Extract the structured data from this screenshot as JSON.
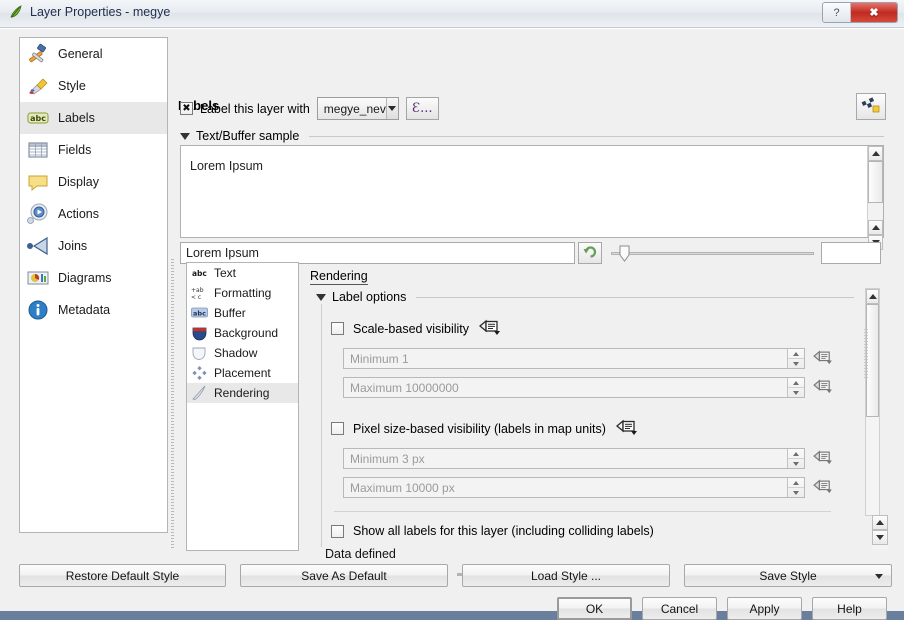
{
  "window": {
    "title": "Layer Properties - megye",
    "app_icon": "qgis-leaf-icon",
    "help_button": "?",
    "close_button": "✖"
  },
  "sidebar": {
    "items": [
      {
        "label": "General",
        "icon": "hammer-icon",
        "selected": false
      },
      {
        "label": "Style",
        "icon": "brush-icon",
        "selected": false
      },
      {
        "label": "Labels",
        "icon": "abc-label-icon",
        "selected": true
      },
      {
        "label": "Fields",
        "icon": "table-icon",
        "selected": false
      },
      {
        "label": "Display",
        "icon": "speech-bubble-icon",
        "selected": false
      },
      {
        "label": "Actions",
        "icon": "gear-play-icon",
        "selected": false
      },
      {
        "label": "Joins",
        "icon": "arrow-left-join-icon",
        "selected": false
      },
      {
        "label": "Diagrams",
        "icon": "chart-icon",
        "selected": false
      },
      {
        "label": "Metadata",
        "icon": "info-icon",
        "selected": false
      }
    ]
  },
  "labels_panel": {
    "title": "Labels",
    "label_layer_checkbox": {
      "label": "Label this layer with",
      "checked": true
    },
    "field_combo": {
      "value": "megye_nev"
    },
    "expression_button": "Ɛ...",
    "label_settings_icon": "label-settings-icon",
    "sample_group": {
      "title": "Text/Buffer sample",
      "expanded": true
    },
    "preview_text": "Lorem Ipsum",
    "sample_input": {
      "value": "Lorem Ipsum"
    },
    "revert_button_icon": "revert-arrow-icon",
    "slider": {
      "value": 5,
      "min": 0,
      "max": 100
    },
    "opacity_box": {
      "value": ""
    }
  },
  "inner_tabs": {
    "items": [
      {
        "label": "Text",
        "icon": "abc-text-icon",
        "selected": false
      },
      {
        "label": "Formatting",
        "icon": "formatting-icon",
        "selected": false
      },
      {
        "label": "Buffer",
        "icon": "abc-buffer-icon",
        "selected": false
      },
      {
        "label": "Background",
        "icon": "shield-icon",
        "selected": false
      },
      {
        "label": "Shadow",
        "icon": "shadow-icon",
        "selected": false
      },
      {
        "label": "Placement",
        "icon": "placement-icon",
        "selected": false
      },
      {
        "label": "Rendering",
        "icon": "rendering-brush-icon",
        "selected": true
      }
    ]
  },
  "rendering": {
    "title": "Rendering",
    "label_options": {
      "title": "Label options",
      "expanded": true,
      "scale_visibility": {
        "label": "Scale-based visibility",
        "checked": false,
        "data_defined_icon": "data-defined-icon",
        "minimum": {
          "placeholder": "Minimum 1",
          "value": ""
        },
        "maximum": {
          "placeholder": "Maximum 10000000",
          "value": ""
        }
      },
      "pixel_visibility": {
        "label": "Pixel size-based visibility (labels in map units)",
        "checked": false,
        "data_defined_icon": "data-defined-icon",
        "minimum": {
          "placeholder": "Minimum 3 px",
          "value": ""
        },
        "maximum": {
          "placeholder": "Maximum 10000 px",
          "value": ""
        }
      },
      "show_all_labels": {
        "label": "Show all labels for this layer (including colliding labels)",
        "checked": false
      },
      "data_defined_label": "Data defined"
    }
  },
  "footer": {
    "style_buttons": [
      {
        "label": "Restore Default Style",
        "has_dropdown": false
      },
      {
        "label": "Save As Default",
        "has_dropdown": false
      },
      {
        "label": "Load Style ...",
        "has_dropdown": false
      },
      {
        "label": "Save Style",
        "has_dropdown": true
      }
    ],
    "action_buttons": [
      {
        "label": "OK",
        "default": true
      },
      {
        "label": "Cancel",
        "default": false
      },
      {
        "label": "Apply",
        "default": false
      },
      {
        "label": "Help",
        "default": false
      }
    ]
  },
  "colors": {
    "window_bg": "#f0f0f0",
    "panel_bg": "#ffffff",
    "selection": "#e8e8e8",
    "close_red": "#c02b20",
    "accent_green": "#6aa84f"
  }
}
